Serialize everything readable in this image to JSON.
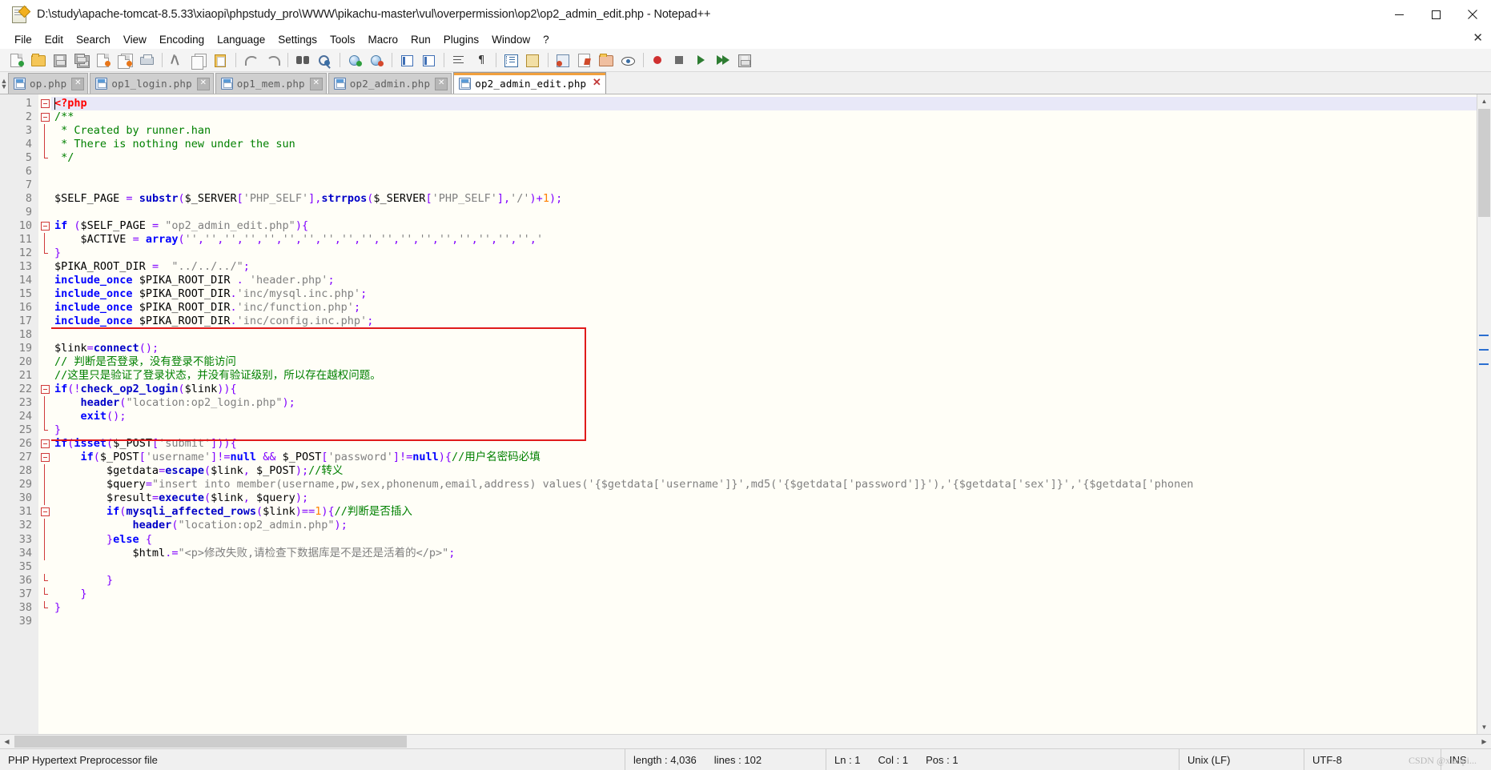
{
  "window": {
    "title": "D:\\study\\apache-tomcat-8.5.33\\xiaopi\\phpstudy_pro\\WWW\\pikachu-master\\vul\\overpermission\\op2\\op2_admin_edit.php - Notepad++",
    "icon": "notepad-plus-plus-icon",
    "minimize": "—",
    "maximize": "☐",
    "close": "✕"
  },
  "menu": {
    "items": [
      "File",
      "Edit",
      "Search",
      "View",
      "Encoding",
      "Language",
      "Settings",
      "Tools",
      "Macro",
      "Run",
      "Plugins",
      "Window",
      "?"
    ],
    "close_label": "✕"
  },
  "toolbar": {
    "buttons": [
      "new-file-icon",
      "open-file-icon",
      "save-icon",
      "save-all-icon",
      "close-file-icon",
      "close-all-icon",
      "print-icon",
      "cut-icon",
      "copy-icon",
      "paste-icon",
      "undo-icon",
      "redo-icon",
      "find-icon",
      "replace-icon",
      "zoom-in-icon",
      "zoom-out-icon",
      "sync-vertical-icon",
      "sync-horizontal-icon",
      "word-wrap-icon",
      "show-all-chars-icon",
      "indent-guide-icon",
      "show-ui-icon",
      "user-defined-lang-icon",
      "function-list-icon",
      "folder-as-workspace-icon",
      "monitor-icon",
      "macro-record-icon",
      "macro-stop-icon",
      "macro-play-icon",
      "macro-playmany-icon",
      "macro-save-icon"
    ]
  },
  "tabs": {
    "items": [
      {
        "label": "op.php",
        "active": false,
        "close": "✕"
      },
      {
        "label": "op1_login.php",
        "active": false,
        "close": "✕"
      },
      {
        "label": "op1_mem.php",
        "active": false,
        "close": "✕"
      },
      {
        "label": "op2_admin.php",
        "active": false,
        "close": "✕"
      },
      {
        "label": "op2_admin_edit.php",
        "active": true,
        "close": "✕"
      }
    ]
  },
  "editor": {
    "first_line": 1,
    "current_line": 1,
    "lines": [
      {
        "n": 1,
        "fold": "open",
        "text": "<?php"
      },
      {
        "n": 2,
        "fold": "open",
        "text": "/**"
      },
      {
        "n": 3,
        "fold": "bar",
        "text": " * Created by runner.han"
      },
      {
        "n": 4,
        "fold": "bar",
        "text": " * There is nothing new under the sun"
      },
      {
        "n": 5,
        "fold": "end",
        "text": " */"
      },
      {
        "n": 6,
        "fold": "none",
        "text": ""
      },
      {
        "n": 7,
        "fold": "none",
        "text": ""
      },
      {
        "n": 8,
        "fold": "none",
        "text": "$SELF_PAGE = substr($_SERVER['PHP_SELF'],strrpos($_SERVER['PHP_SELF'],'/')+1);"
      },
      {
        "n": 9,
        "fold": "none",
        "text": ""
      },
      {
        "n": 10,
        "fold": "open",
        "text": "if ($SELF_PAGE = \"op2_admin_edit.php\"){"
      },
      {
        "n": 11,
        "fold": "bar",
        "text": "    $ACTIVE = array('','','','','','','','','','','','','','','','','','','"
      },
      {
        "n": 12,
        "fold": "end",
        "text": "}"
      },
      {
        "n": 13,
        "fold": "none",
        "text": "$PIKA_ROOT_DIR =  \"../../../\";"
      },
      {
        "n": 14,
        "fold": "none",
        "text": "include_once $PIKA_ROOT_DIR . 'header.php';"
      },
      {
        "n": 15,
        "fold": "none",
        "text": "include_once $PIKA_ROOT_DIR.'inc/mysql.inc.php';"
      },
      {
        "n": 16,
        "fold": "none",
        "text": "include_once $PIKA_ROOT_DIR.'inc/function.php';"
      },
      {
        "n": 17,
        "fold": "none",
        "text": "include_once $PIKA_ROOT_DIR.'inc/config.inc.php';"
      },
      {
        "n": 18,
        "fold": "none",
        "text": ""
      },
      {
        "n": 19,
        "fold": "none",
        "text": "$link=connect();"
      },
      {
        "n": 20,
        "fold": "none",
        "text": "// 判断是否登录，没有登录不能访问"
      },
      {
        "n": 21,
        "fold": "none",
        "text": "//这里只是验证了登录状态，并没有验证级别，所以存在越权问题。"
      },
      {
        "n": 22,
        "fold": "open",
        "text": "if(!check_op2_login($link)){"
      },
      {
        "n": 23,
        "fold": "bar",
        "text": "    header(\"location:op2_login.php\");"
      },
      {
        "n": 24,
        "fold": "bar",
        "text": "    exit();"
      },
      {
        "n": 25,
        "fold": "end",
        "text": "}"
      },
      {
        "n": 26,
        "fold": "open",
        "text": "if(isset($_POST['submit'])){"
      },
      {
        "n": 27,
        "fold": "open2",
        "text": "    if($_POST['username']!=null && $_POST['password']!=null){//用户名密码必填"
      },
      {
        "n": 28,
        "fold": "bar2",
        "text": "        $getdata=escape($link, $_POST);//转义"
      },
      {
        "n": 29,
        "fold": "bar2",
        "text": "        $query=\"insert into member(username,pw,sex,phonenum,email,address) values('{$getdata['username']}',md5('{$getdata['password']}'),'{$getdata['sex']}','{$getdata['phonen"
      },
      {
        "n": 30,
        "fold": "bar2",
        "text": "        $result=execute($link, $query);"
      },
      {
        "n": 31,
        "fold": "open3",
        "text": "        if(mysqli_affected_rows($link)==1){//判断是否插入"
      },
      {
        "n": 32,
        "fold": "bar3",
        "text": "            header(\"location:op2_admin.php\");"
      },
      {
        "n": 33,
        "fold": "bar3",
        "text": "        }else {"
      },
      {
        "n": 34,
        "fold": "bar3",
        "text": "            $html.=\"<p>修改失败,请检查下数据库是不是还是活着的</p>\";"
      },
      {
        "n": 35,
        "fold": "none",
        "text": ""
      },
      {
        "n": 36,
        "fold": "end3",
        "text": "        }"
      },
      {
        "n": 37,
        "fold": "end2",
        "text": "    }"
      },
      {
        "n": 38,
        "fold": "end",
        "text": "}"
      },
      {
        "n": 39,
        "fold": "none",
        "text": ""
      }
    ],
    "annotation": {
      "type": "red-rectangle",
      "from_line": 18,
      "to_line": 25
    }
  },
  "statusbar": {
    "filetype": "PHP Hypertext Preprocessor file",
    "length_label": "length : 4,036",
    "lines_label": "lines : 102",
    "ln": "Ln : 1",
    "col": "Col : 1",
    "pos": "Pos : 1",
    "eol": "Unix (LF)",
    "encoding": "UTF-8",
    "insert": "INS"
  },
  "watermark": "CSDN @xiaopi...",
  "colors": {
    "accent": "#f2a03d",
    "annotation": "#e01b1b",
    "keyword": "#0000ff",
    "comment": "#008000",
    "string": "#808080",
    "tag": "#ff0000",
    "number": "#ff8000"
  }
}
